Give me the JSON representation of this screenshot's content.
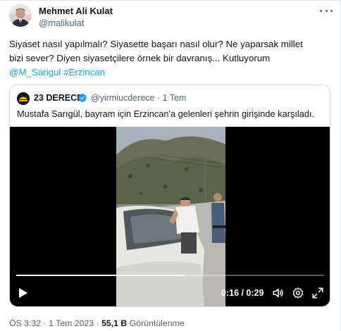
{
  "tweet": {
    "author_name": "Mehmet Ali Kulat",
    "author_handle": "@malikulat",
    "text_line1": "Siyaset nasıl yapılmalı? Siyasette başarı nasıl olur? Ne yaparsak millet",
    "text_line2": "bizi sever? Diyen siyasetçilere örnek bir davranış... Kutluyorum",
    "hashtag_mention": "@M_Sarigul",
    "hashtag": "#Erzincan",
    "time": "ÖS 3:32",
    "separator": "·",
    "date": "1 Tem 2023",
    "views_count": "55,1 B",
    "views_label": "Görüntülenme"
  },
  "quote": {
    "author_name": "23 DERECE",
    "author_handle": "@yirmiucderece",
    "separator": "·",
    "age": "1 Tem",
    "text": "Mustafa Sarıgül, bayram için Erzincan'a gelenleri şehrin girişinde karşıladı."
  },
  "video": {
    "time_display": "0:16 / 0:29",
    "progress": 0.55
  },
  "icons": {
    "more": "more-horizontal-icon",
    "verified": "verified-badge-icon",
    "play": "play-icon",
    "volume": "volume-icon",
    "settings": "settings-gear-icon",
    "fullscreen": "fullscreen-icon"
  },
  "colors": {
    "link": "#1d9bf0",
    "secondary_text": "#536471",
    "verified": "#1d9bf0",
    "border": "#cfd9de"
  }
}
